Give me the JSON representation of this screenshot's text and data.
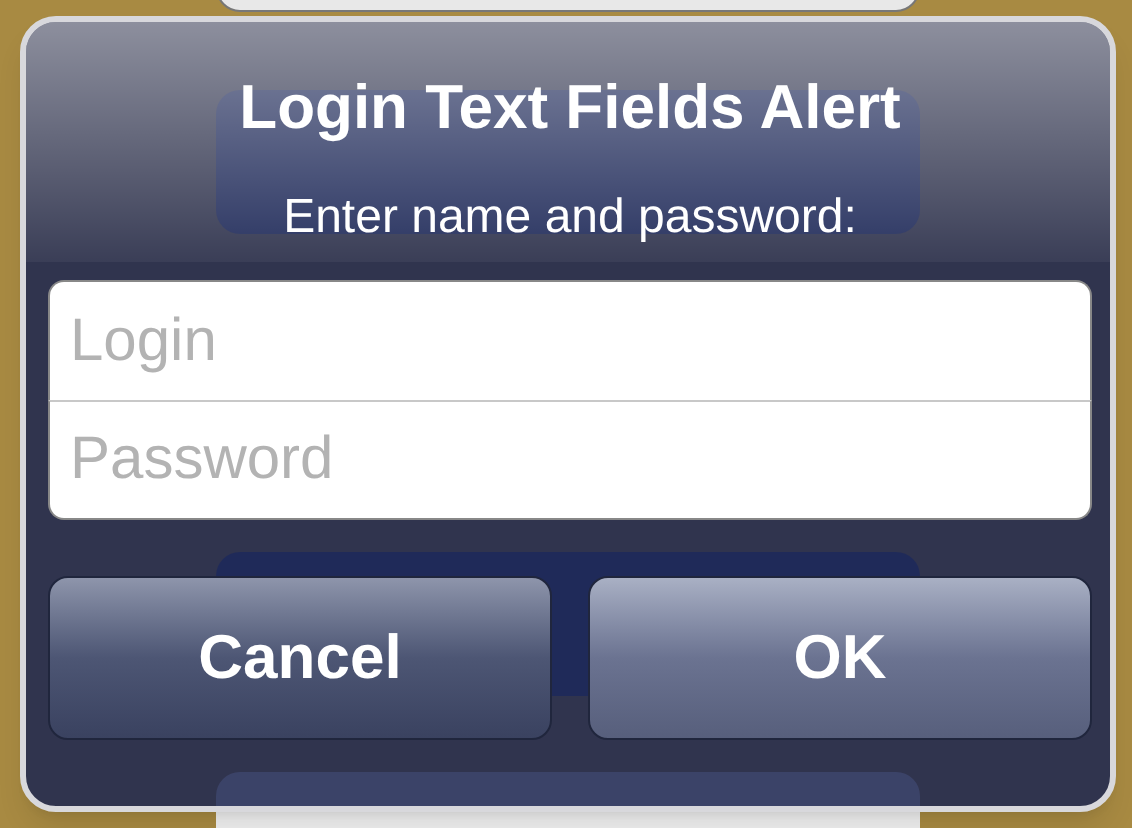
{
  "alert": {
    "title": "Login Text Fields Alert",
    "message": "Enter name and password:",
    "fields": [
      {
        "placeholder": "Login"
      },
      {
        "placeholder": "Password"
      }
    ],
    "buttons": [
      {
        "label": "Cancel",
        "kind": "cancel"
      },
      {
        "label": "OK",
        "kind": "default"
      }
    ]
  }
}
